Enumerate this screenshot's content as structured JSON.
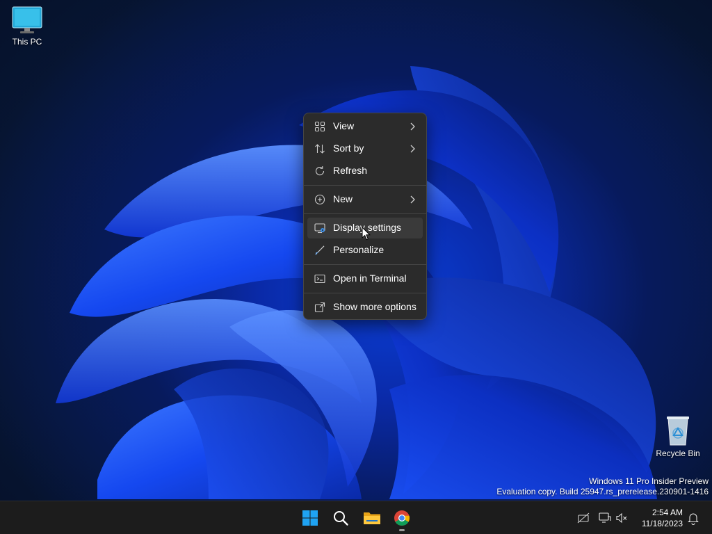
{
  "desktop": {
    "icons": [
      {
        "label": "This PC",
        "icon": "monitor-icon"
      },
      {
        "label": "Recycle Bin",
        "icon": "recycle-bin-icon"
      }
    ],
    "watermark": {
      "line1": "Windows 11 Pro Insider Preview",
      "line2": "Evaluation copy. Build 25947.rs_prerelease.230901-1416"
    }
  },
  "context_menu": {
    "items": [
      {
        "label": "View",
        "icon": "grid-view-icon",
        "submenu": true
      },
      {
        "label": "Sort by",
        "icon": "sort-arrows-icon",
        "submenu": true
      },
      {
        "label": "Refresh",
        "icon": "refresh-icon",
        "submenu": false
      },
      {
        "label": "New",
        "icon": "plus-circle-icon",
        "submenu": true
      },
      {
        "label": "Display settings",
        "icon": "display-settings-icon",
        "submenu": false,
        "highlighted": true
      },
      {
        "label": "Personalize",
        "icon": "brush-icon",
        "submenu": false
      },
      {
        "label": "Open in Terminal",
        "icon": "terminal-icon",
        "submenu": false
      },
      {
        "label": "Show more options",
        "icon": "more-options-icon",
        "submenu": false
      }
    ]
  },
  "taskbar": {
    "apps": [
      {
        "name": "Start",
        "icon": "windows-logo-icon"
      },
      {
        "name": "Search",
        "icon": "search-icon"
      },
      {
        "name": "File Explorer",
        "icon": "folder-icon"
      },
      {
        "name": "Google Chrome",
        "icon": "chrome-icon",
        "running": true
      }
    ],
    "tray": {
      "icons": [
        "network-disconnected-icon",
        "display-icon",
        "volume-muted-icon",
        "notification-bell-icon"
      ],
      "time": "2:54 AM",
      "date": "11/18/2023"
    }
  },
  "colors": {
    "menu_bg": "#2b2b2b",
    "menu_highlight": "#3a3a3a",
    "accent_blue": "#0b3fd8",
    "taskbar_bg": "#1c1c1c"
  }
}
